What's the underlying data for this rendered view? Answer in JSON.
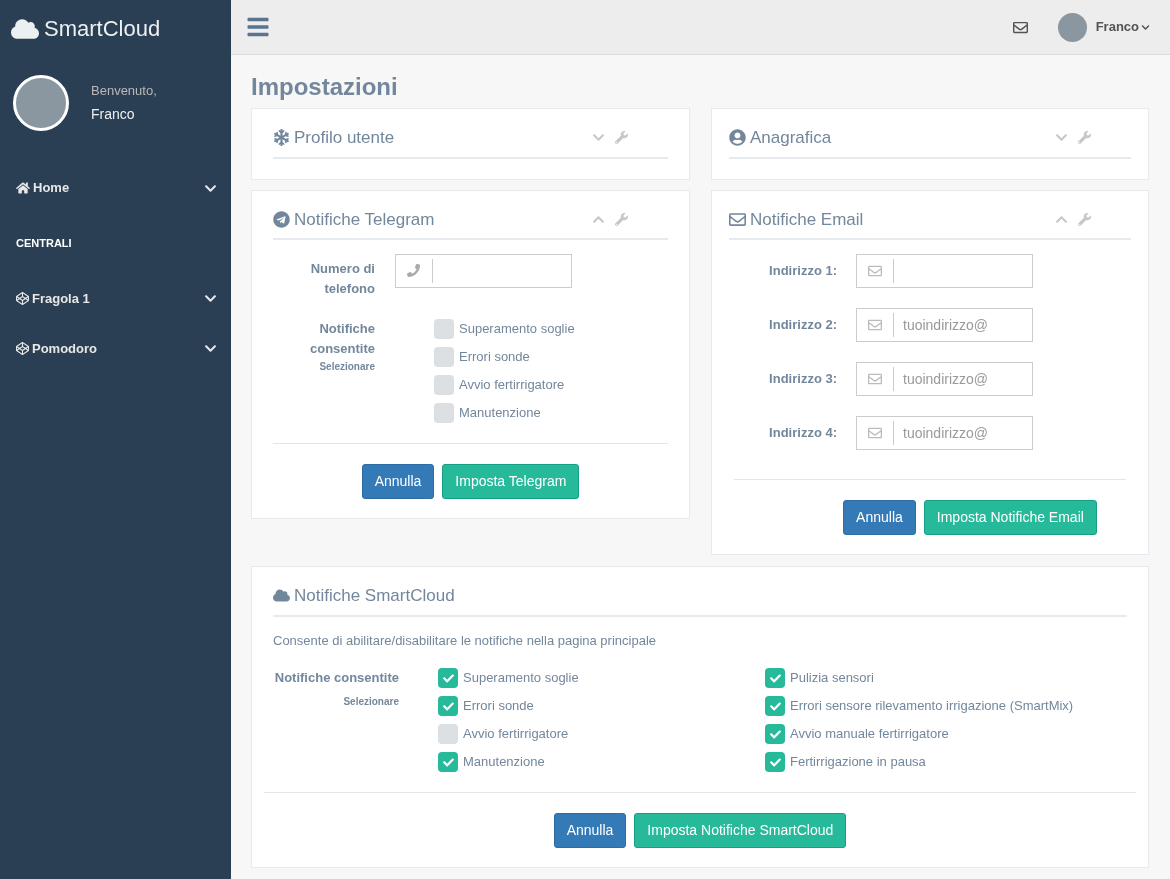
{
  "sidebar": {
    "brand": "SmartCloud",
    "welcome": "Benvenuto,",
    "user_name": "Franco",
    "menu": [
      {
        "kind": "item",
        "label": "Home",
        "expanded": false
      },
      {
        "kind": "section",
        "label": "CENTRALI"
      },
      {
        "kind": "item",
        "label": "Fragola 1",
        "expanded": false
      },
      {
        "kind": "item",
        "label": "Pomodoro",
        "expanded": false
      }
    ]
  },
  "topbar": {
    "user_name": "Franco"
  },
  "page_title": "Impostazioni",
  "profile_panel": {
    "title": "Profilo utente",
    "expanded": false
  },
  "personal_panel": {
    "title": "Anagrafica",
    "expanded": false
  },
  "telegram_panel": {
    "title": "Notifiche Telegram",
    "expanded": true,
    "phone_label": "Numero di telefono",
    "notify_label": "Notifiche consentite",
    "notify_hint": "Selezionare",
    "options": [
      {
        "label": "Superamento soglie",
        "checked": false
      },
      {
        "label": "Errori sonde",
        "checked": false
      },
      {
        "label": "Avvio fertirrigatore",
        "checked": false
      },
      {
        "label": "Manutenzione",
        "checked": false
      }
    ],
    "buttons": [
      {
        "kind": "cancel",
        "label": "Annulla"
      },
      {
        "kind": "submit",
        "label": "Imposta Telegram"
      }
    ]
  },
  "email_panel": {
    "title": "Notifiche Email",
    "expanded": true,
    "addresses": [
      {
        "label": "Indirizzo 1:"
      },
      {
        "label": "Indirizzo 2:",
        "placeholder": "tuoindirizzo@"
      },
      {
        "label": "Indirizzo 3:",
        "placeholder": "tuoindirizzo@"
      },
      {
        "label": "Indirizzo 4:",
        "placeholder": "tuoindirizzo@"
      }
    ],
    "buttons": [
      {
        "kind": "cancel",
        "label": "Annulla"
      },
      {
        "kind": "submit",
        "label": "Imposta Notifiche Email"
      }
    ]
  },
  "smartcloud_panel": {
    "title": "Notifiche SmartCloud",
    "description": "Consente di abilitare/disabilitare le notifiche nella pagina principale",
    "notify_label": "Notifiche consentite",
    "notify_hint": "Selezionare",
    "options_left": [
      {
        "label": "Superamento soglie",
        "checked": true
      },
      {
        "label": "Errori sonde",
        "checked": true
      },
      {
        "label": "Avvio fertirrigatore",
        "checked": false
      },
      {
        "label": "Manutenzione",
        "checked": true
      }
    ],
    "options_right": [
      {
        "label": "Pulizia sensori",
        "checked": true
      },
      {
        "label": "Errori sensore rilevamento irrigazione (SmartMix)",
        "checked": true
      },
      {
        "label": "Avvio manuale fertirrigatore",
        "checked": true
      },
      {
        "label": "Fertirrigazione in pausa",
        "checked": true
      }
    ],
    "buttons": [
      {
        "kind": "cancel",
        "label": "Annulla"
      },
      {
        "kind": "submit",
        "label": "Imposta Notifiche SmartCloud"
      }
    ]
  }
}
